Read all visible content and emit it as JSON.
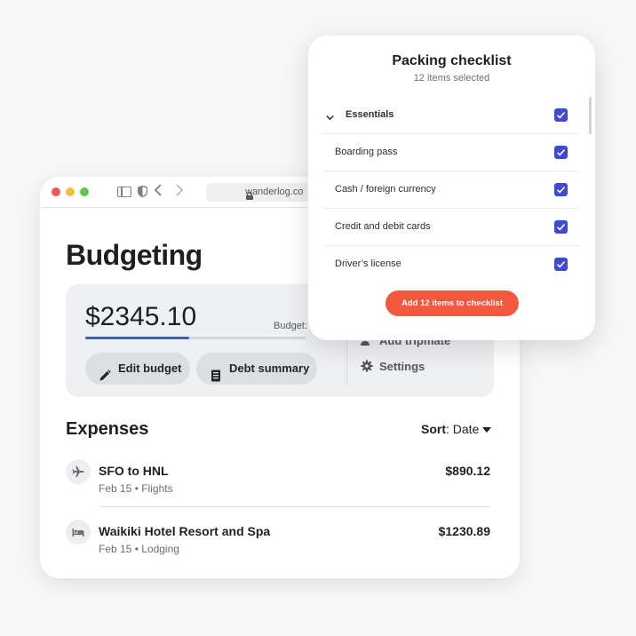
{
  "browser": {
    "url": "wanderlog.co",
    "colors": {
      "close": "#ee5b52",
      "minimize": "#f4bd3b",
      "maximize": "#5fc44c"
    }
  },
  "budget": {
    "heading": "Budgeting",
    "amount": "$2345.10",
    "budget_label": "Budget:",
    "progress_fraction": 0.47,
    "edit_label": "Edit budget",
    "debt_label": "Debt summary",
    "add_tripmate_label": "Add tripmate",
    "settings_label": "Settings"
  },
  "expenses": {
    "title": "Expenses",
    "sort_label": "Sort",
    "sort_value": ": Date",
    "items": [
      {
        "name": "SFO to HNL",
        "meta": "Feb 15 • Flights",
        "amount": "$890.12",
        "icon": "plane-icon"
      },
      {
        "name": "Waikiki Hotel Resort and Spa",
        "meta": "Feb 15 • Lodging",
        "amount": "$1230.89",
        "icon": "bed-icon"
      }
    ]
  },
  "checklist": {
    "title": "Packing checklist",
    "subtitle": "12 items selected",
    "group": "Essentials",
    "items": [
      {
        "label": "Boarding pass",
        "checked": true
      },
      {
        "label": "Cash / foreign currency",
        "checked": true
      },
      {
        "label": "Credit and debit cards",
        "checked": true
      },
      {
        "label": "Driver’s license",
        "checked": true
      }
    ],
    "button_label": "Add 12 items to checklist",
    "accent": "#3e4ad1",
    "button_color": "#f2583e"
  }
}
